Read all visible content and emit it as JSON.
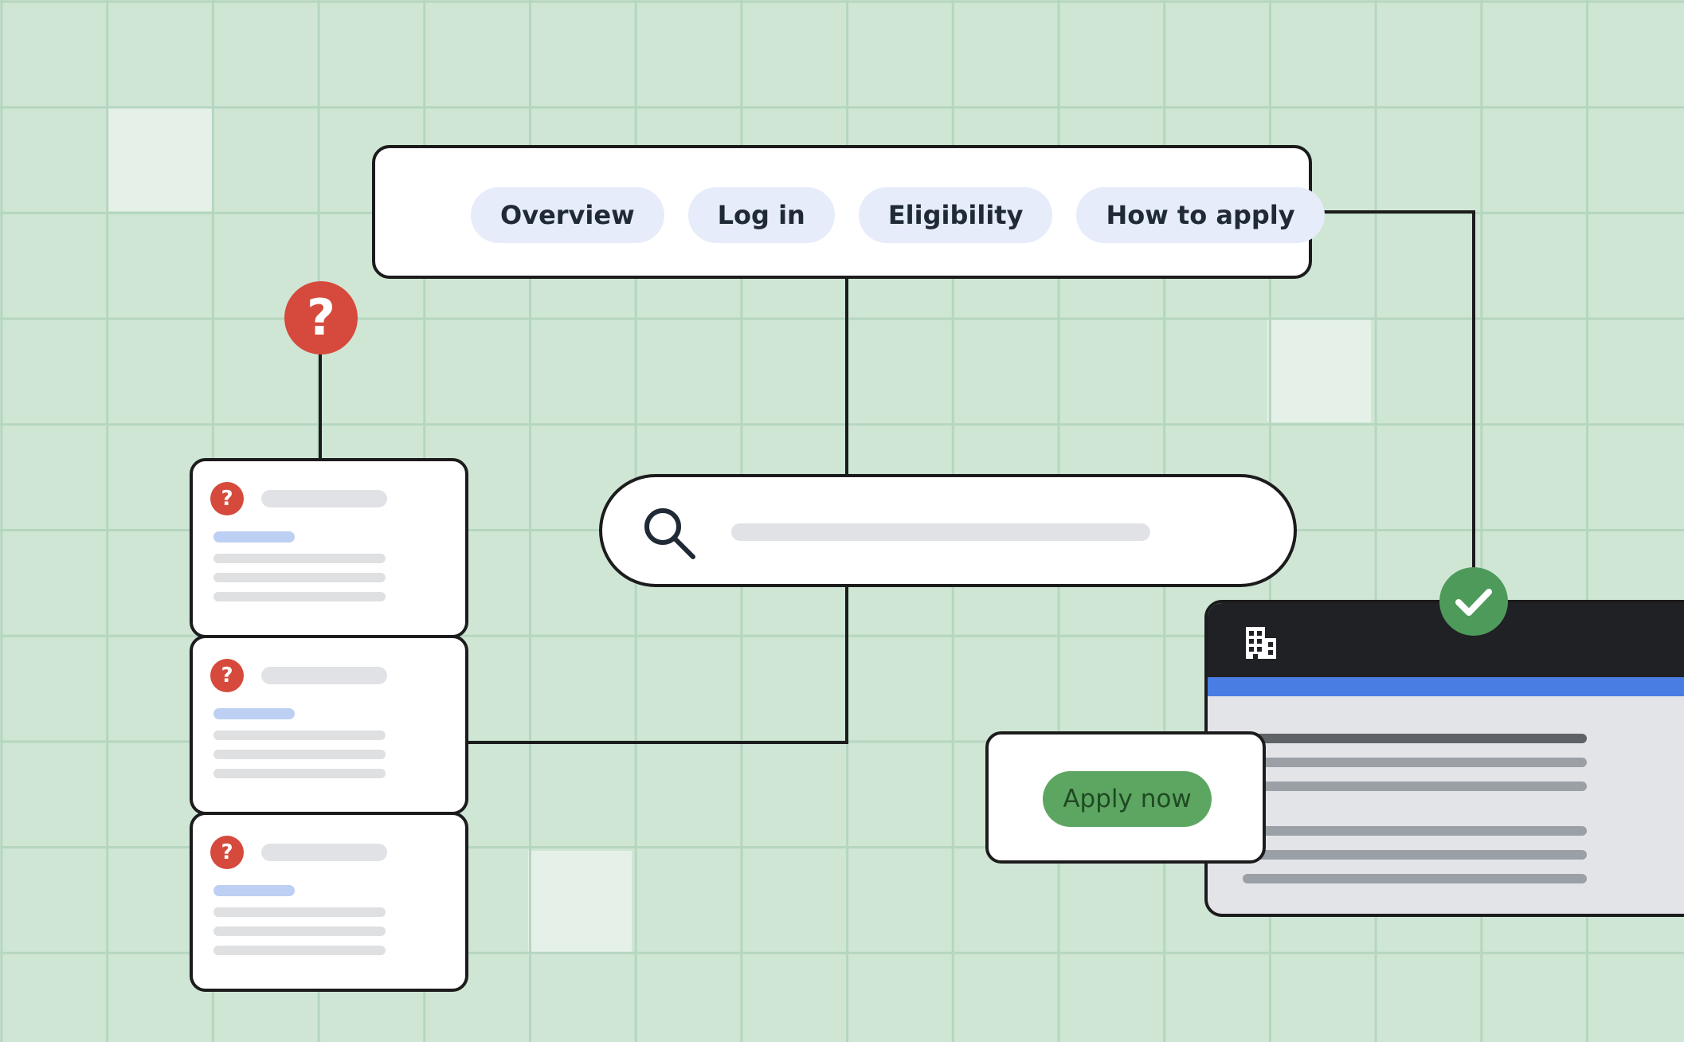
{
  "nav": {
    "chips": [
      "Overview",
      "Log in",
      "Eligibility",
      "How to apply"
    ]
  },
  "card_badge_glyph": "?",
  "big_badge_glyph": "?",
  "apply": {
    "label": "Apply now"
  },
  "icons": {
    "search": "search-icon",
    "building": "building-icon",
    "check": "check-icon",
    "question": "question-icon"
  },
  "colors": {
    "background": "#cfe6d5",
    "grid_line": "#b5d6bf",
    "highlight_tile": "#e5f1e8",
    "question_red": "#d54a3c",
    "check_green": "#4e9a5b",
    "button_green": "#5da662",
    "accent_blue": "#4a7de3",
    "chip_blue": "#e6ecfa",
    "window_dark": "#202124"
  }
}
